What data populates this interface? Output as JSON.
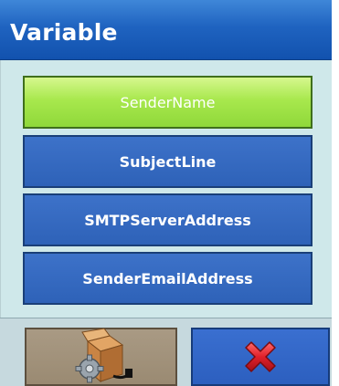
{
  "window": {
    "title": "Variable"
  },
  "variables": {
    "items": [
      {
        "label": "SenderName",
        "selected": true
      },
      {
        "label": "SubjectLine",
        "selected": false
      },
      {
        "label": "SMTPServerAddress",
        "selected": false
      },
      {
        "label": "SenderEmailAddress",
        "selected": false
      }
    ]
  },
  "toolbar": {
    "settings_icon": "box-gear-icon",
    "cancel_icon": "red-x-icon"
  },
  "colors": {
    "title_bar": "#1f63c0",
    "selected_item": "#a8e84d",
    "item": "#2e62b8",
    "cancel_x": "#e0202a"
  }
}
